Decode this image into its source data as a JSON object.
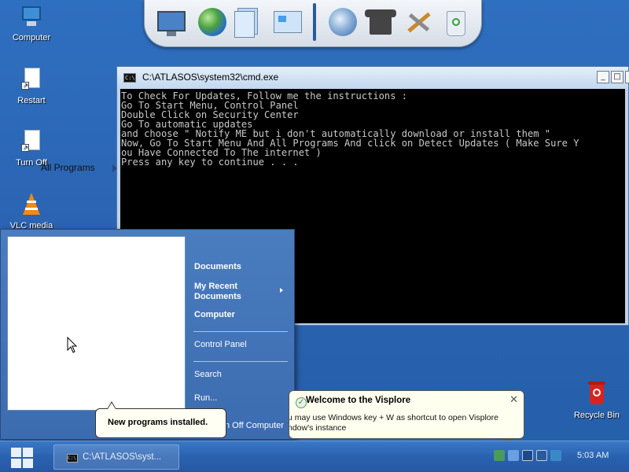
{
  "desktop": {
    "icons": [
      {
        "label": "Computer",
        "icon": "computer-icon"
      },
      {
        "label": "Restart",
        "icon": "shortcut-document-icon"
      },
      {
        "label": "Turn Off",
        "icon": "shortcut-document-icon"
      },
      {
        "label": "VLC media",
        "icon": "vlc-cone-icon"
      },
      {
        "label": "Recycle Bin",
        "icon": "recycle-bin-icon"
      }
    ]
  },
  "dock": {
    "items": [
      "monitor-icon",
      "globe-icon",
      "files-icon",
      "window-icon",
      "earth-icon",
      "tshirt-icon",
      "tools-icon",
      "recycle-bin-icon"
    ]
  },
  "cmd": {
    "title": "C:\\ATLASOS\\system32\\cmd.exe",
    "icon_text": "C:\\",
    "buttons": {
      "minimize": "_",
      "maximize": "□",
      "close": "✕"
    },
    "lines": [
      "To Check For Updates, Follow me the instructions :",
      "Go To Start Menu, Control Panel",
      "Double Click on Security Center",
      "Go To automatic updates",
      "and choose \" Notify ME but i don't automatically download or install them \"",
      "Now, Go To Start Menu And All Programs And click on Detect Updates ( Make Sure Y",
      "ou Have Connected To The internet )",
      "Press any key to continue . . ."
    ]
  },
  "start_menu": {
    "all_programs": "All Programs",
    "right_items": {
      "documents": "Documents",
      "recent_line1": "My Recent",
      "recent_line2": "Documents",
      "computer": "Computer",
      "control_panel": "Control Panel",
      "search": "Search",
      "run": "Run...",
      "turn_off": "n Off Computer"
    }
  },
  "tooltip": {
    "new_programs": "New programs installed."
  },
  "balloon": {
    "title": "Welcome to the Visplore",
    "close": "✕",
    "line1": "u may use Windows key + W as shortcut to open Visplore",
    "line2": "ndow's instance"
  },
  "taskbar": {
    "task_label": "C:\\ATLASOS\\syst...",
    "clock": "5:03 AM"
  }
}
